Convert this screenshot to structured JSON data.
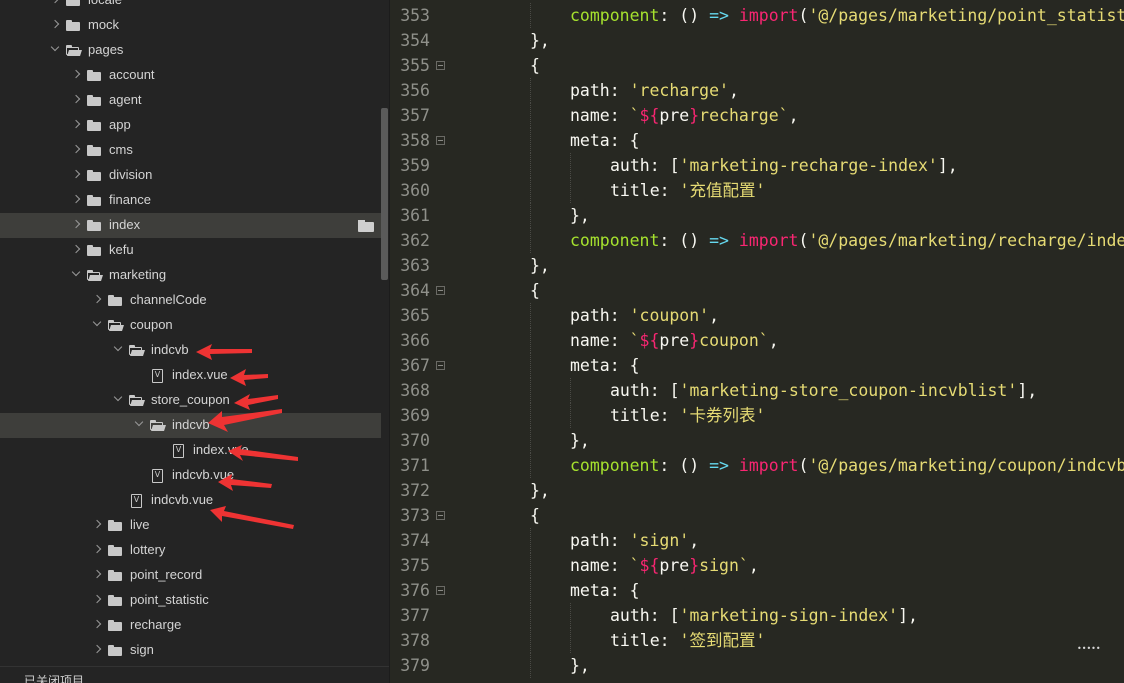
{
  "sidebar": {
    "tree": [
      {
        "label": "locale",
        "depth": 0,
        "type": "folder",
        "state": "closed"
      },
      {
        "label": "mock",
        "depth": 0,
        "type": "folder",
        "state": "closed"
      },
      {
        "label": "pages",
        "depth": 0,
        "type": "folder",
        "state": "open"
      },
      {
        "label": "account",
        "depth": 1,
        "type": "folder",
        "state": "closed"
      },
      {
        "label": "agent",
        "depth": 1,
        "type": "folder",
        "state": "closed"
      },
      {
        "label": "app",
        "depth": 1,
        "type": "folder",
        "state": "closed"
      },
      {
        "label": "cms",
        "depth": 1,
        "type": "folder",
        "state": "closed"
      },
      {
        "label": "division",
        "depth": 1,
        "type": "folder",
        "state": "closed"
      },
      {
        "label": "finance",
        "depth": 1,
        "type": "folder",
        "state": "closed"
      },
      {
        "label": "index",
        "depth": 1,
        "type": "folder",
        "state": "closed",
        "hover": true
      },
      {
        "label": "kefu",
        "depth": 1,
        "type": "folder",
        "state": "closed"
      },
      {
        "label": "marketing",
        "depth": 1,
        "type": "folder",
        "state": "open"
      },
      {
        "label": "channelCode",
        "depth": 2,
        "type": "folder",
        "state": "closed"
      },
      {
        "label": "coupon",
        "depth": 2,
        "type": "folder",
        "state": "open"
      },
      {
        "label": "indcvb",
        "depth": 3,
        "type": "folder",
        "state": "open"
      },
      {
        "label": "index.vue",
        "depth": 4,
        "type": "file"
      },
      {
        "label": "store_coupon",
        "depth": 3,
        "type": "folder",
        "state": "open"
      },
      {
        "label": "indcvb",
        "depth": 4,
        "type": "folder",
        "state": "open",
        "selected": true
      },
      {
        "label": "index.vue",
        "depth": 5,
        "type": "file"
      },
      {
        "label": "indcvb.vue",
        "depth": 4,
        "type": "file"
      },
      {
        "label": "indcvb.vue",
        "depth": 3,
        "type": "file"
      },
      {
        "label": "live",
        "depth": 2,
        "type": "folder",
        "state": "closed"
      },
      {
        "label": "lottery",
        "depth": 2,
        "type": "folder",
        "state": "closed"
      },
      {
        "label": "point_record",
        "depth": 2,
        "type": "folder",
        "state": "closed"
      },
      {
        "label": "point_statistic",
        "depth": 2,
        "type": "folder",
        "state": "closed"
      },
      {
        "label": "recharge",
        "depth": 2,
        "type": "folder",
        "state": "closed"
      },
      {
        "label": "sign",
        "depth": 2,
        "type": "folder",
        "state": "closed"
      }
    ],
    "footer_label": "已关闭项目"
  },
  "editor": {
    "lines": [
      {
        "n": "353",
        "fold": false,
        "indent": 2,
        "tokens": [
          [
            "k",
            "component"
          ],
          [
            "w",
            ": () "
          ],
          [
            "a",
            "=>"
          ],
          [
            "w",
            " "
          ],
          [
            "p",
            "import"
          ],
          [
            "w",
            "("
          ],
          [
            "s",
            "'@/pages/marketing/point_statistic"
          ]
        ]
      },
      {
        "n": "354",
        "fold": false,
        "indent": 1,
        "tokens": [
          [
            "w",
            "},"
          ]
        ]
      },
      {
        "n": "355",
        "fold": true,
        "indent": 1,
        "tokens": [
          [
            "w",
            "{"
          ]
        ]
      },
      {
        "n": "356",
        "fold": false,
        "indent": 2,
        "tokens": [
          [
            "w",
            "path: "
          ],
          [
            "s",
            "'recharge'"
          ],
          [
            "w",
            ","
          ]
        ]
      },
      {
        "n": "357",
        "fold": false,
        "indent": 2,
        "tokens": [
          [
            "w",
            "name: "
          ],
          [
            "s",
            "`"
          ],
          [
            "p",
            "${"
          ],
          [
            "w",
            "pre"
          ],
          [
            "p",
            "}"
          ],
          [
            "s",
            "recharge`"
          ],
          [
            "w",
            ","
          ]
        ]
      },
      {
        "n": "358",
        "fold": true,
        "indent": 2,
        "tokens": [
          [
            "w",
            "meta: {"
          ]
        ]
      },
      {
        "n": "359",
        "fold": false,
        "indent": 3,
        "tokens": [
          [
            "w",
            "auth: ["
          ],
          [
            "s",
            "'marketing-recharge-index'"
          ],
          [
            "w",
            "],"
          ]
        ]
      },
      {
        "n": "360",
        "fold": false,
        "indent": 3,
        "tokens": [
          [
            "w",
            "title: "
          ],
          [
            "s",
            "'充值配置'"
          ]
        ]
      },
      {
        "n": "361",
        "fold": false,
        "indent": 2,
        "tokens": [
          [
            "w",
            "},"
          ]
        ]
      },
      {
        "n": "362",
        "fold": false,
        "indent": 2,
        "tokens": [
          [
            "k",
            "component"
          ],
          [
            "w",
            ": () "
          ],
          [
            "a",
            "=>"
          ],
          [
            "w",
            " "
          ],
          [
            "p",
            "import"
          ],
          [
            "w",
            "("
          ],
          [
            "s",
            "'@/pages/marketing/recharge/index"
          ]
        ]
      },
      {
        "n": "363",
        "fold": false,
        "indent": 1,
        "tokens": [
          [
            "w",
            "},"
          ]
        ]
      },
      {
        "n": "364",
        "fold": true,
        "indent": 1,
        "tokens": [
          [
            "w",
            "{"
          ]
        ]
      },
      {
        "n": "365",
        "fold": false,
        "indent": 2,
        "tokens": [
          [
            "w",
            "path: "
          ],
          [
            "s",
            "'coupon'"
          ],
          [
            "w",
            ","
          ]
        ]
      },
      {
        "n": "366",
        "fold": false,
        "indent": 2,
        "tokens": [
          [
            "w",
            "name: "
          ],
          [
            "s",
            "`"
          ],
          [
            "p",
            "${"
          ],
          [
            "w",
            "pre"
          ],
          [
            "p",
            "}"
          ],
          [
            "s",
            "coupon`"
          ],
          [
            "w",
            ","
          ]
        ]
      },
      {
        "n": "367",
        "fold": true,
        "indent": 2,
        "tokens": [
          [
            "w",
            "meta: {"
          ]
        ]
      },
      {
        "n": "368",
        "fold": false,
        "indent": 3,
        "tokens": [
          [
            "w",
            "auth: ["
          ],
          [
            "s",
            "'marketing-store_coupon-incvblist'"
          ],
          [
            "w",
            "],"
          ]
        ]
      },
      {
        "n": "369",
        "fold": false,
        "indent": 3,
        "tokens": [
          [
            "w",
            "title: "
          ],
          [
            "s",
            "'卡券列表'"
          ]
        ]
      },
      {
        "n": "370",
        "fold": false,
        "indent": 2,
        "tokens": [
          [
            "w",
            "},"
          ]
        ]
      },
      {
        "n": "371",
        "fold": false,
        "indent": 2,
        "tokens": [
          [
            "k",
            "component"
          ],
          [
            "w",
            ": () "
          ],
          [
            "a",
            "=>"
          ],
          [
            "w",
            " "
          ],
          [
            "p",
            "import"
          ],
          [
            "w",
            "("
          ],
          [
            "s",
            "'@/pages/marketing/coupon/indcvb"
          ]
        ]
      },
      {
        "n": "372",
        "fold": false,
        "indent": 1,
        "tokens": [
          [
            "w",
            "},"
          ]
        ]
      },
      {
        "n": "373",
        "fold": true,
        "indent": 1,
        "tokens": [
          [
            "w",
            "{"
          ]
        ]
      },
      {
        "n": "374",
        "fold": false,
        "indent": 2,
        "tokens": [
          [
            "w",
            "path: "
          ],
          [
            "s",
            "'sign'"
          ],
          [
            "w",
            ","
          ]
        ]
      },
      {
        "n": "375",
        "fold": false,
        "indent": 2,
        "tokens": [
          [
            "w",
            "name: "
          ],
          [
            "s",
            "`"
          ],
          [
            "p",
            "${"
          ],
          [
            "w",
            "pre"
          ],
          [
            "p",
            "}"
          ],
          [
            "s",
            "sign`"
          ],
          [
            "w",
            ","
          ]
        ]
      },
      {
        "n": "376",
        "fold": true,
        "indent": 2,
        "tokens": [
          [
            "w",
            "meta: {"
          ]
        ]
      },
      {
        "n": "377",
        "fold": false,
        "indent": 3,
        "tokens": [
          [
            "w",
            "auth: ["
          ],
          [
            "s",
            "'marketing-sign-index'"
          ],
          [
            "w",
            "],"
          ]
        ]
      },
      {
        "n": "378",
        "fold": false,
        "indent": 3,
        "tokens": [
          [
            "w",
            "title: "
          ],
          [
            "s",
            "'签到配置'"
          ]
        ]
      },
      {
        "n": "379",
        "fold": false,
        "indent": 2,
        "tokens": [
          [
            "w",
            "},"
          ]
        ]
      }
    ]
  },
  "watermark": "•••••"
}
